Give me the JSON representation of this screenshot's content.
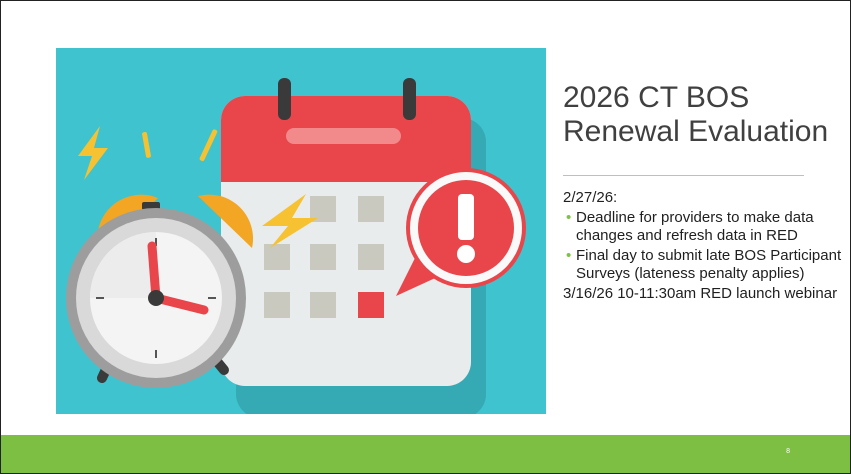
{
  "slide": {
    "title_line1": "2026 CT BOS",
    "title_line2": "Renewal Evaluation",
    "date1": "2/27/26:",
    "bullets": [
      "Deadline for providers to make data changes and refresh data in RED",
      "Final day to submit late BOS Participant Surveys (lateness penalty applies)"
    ],
    "date2": "3/16/26 10-11:30am RED launch webinar",
    "page_number": "8"
  },
  "colors": {
    "accent_green": "#7dbf42",
    "illustration_bg": "#3fc3cf",
    "calendar_red": "#e8464b",
    "clock_orange": "#f2a623"
  },
  "illustration": {
    "icons": [
      "calendar-icon",
      "alarm-clock-icon",
      "exclamation-bubble-icon",
      "lightning-bolt-icon"
    ]
  }
}
